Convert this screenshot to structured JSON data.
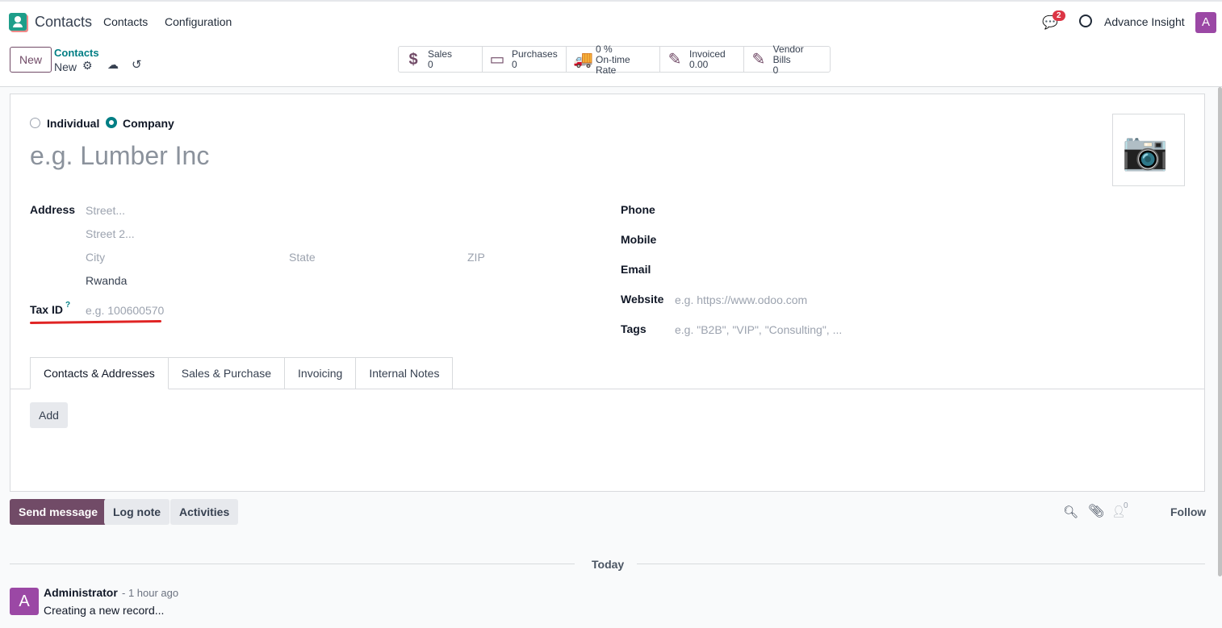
{
  "nav": {
    "app_title": "Contacts",
    "menu": [
      "Contacts",
      "Configuration"
    ],
    "messages_count": "2",
    "user_name": "Advance Insight",
    "avatar_letter": "A"
  },
  "control": {
    "new_label": "New",
    "breadcrumb_parent": "Contacts",
    "breadcrumb_current": "New"
  },
  "stats": [
    {
      "icon": "dollar-icon",
      "label": "Sales",
      "value": "0"
    },
    {
      "icon": "credit-card-icon",
      "label": "Purchases",
      "value": "0"
    },
    {
      "icon": "truck-icon",
      "label": "0 %",
      "value": "On-time Rate"
    },
    {
      "icon": "edit-icon",
      "label": "Invoiced",
      "value": "0.00"
    },
    {
      "icon": "edit-icon",
      "label": "Vendor Bills",
      "value": "0"
    }
  ],
  "form": {
    "type_options": [
      "Individual",
      "Company"
    ],
    "type_selected": "Company",
    "name_placeholder": "e.g. Lumber Inc",
    "address_label": "Address",
    "street_ph": "Street...",
    "street2_ph": "Street 2...",
    "city_ph": "City",
    "state_ph": "State",
    "zip_ph": "ZIP",
    "country": "Rwanda",
    "taxid_label": "Tax ID",
    "taxid_help": "?",
    "taxid_ph": "e.g. 100600570",
    "phone_label": "Phone",
    "mobile_label": "Mobile",
    "email_label": "Email",
    "website_label": "Website",
    "website_ph": "e.g. https://www.odoo.com",
    "tags_label": "Tags",
    "tags_ph": "e.g. \"B2B\", \"VIP\", \"Consulting\", ...",
    "highlight_color": "#e02424"
  },
  "tabs": [
    "Contacts & Addresses",
    "Sales & Purchase",
    "Invoicing",
    "Internal Notes"
  ],
  "add_label": "Add",
  "chatter": {
    "send": "Send message",
    "log": "Log note",
    "activities": "Activities",
    "followers": "0",
    "follow": "Follow",
    "today": "Today",
    "messages": [
      {
        "avatar": "A",
        "author": "Administrator",
        "time": "- 1 hour ago",
        "body": "Creating a new record..."
      }
    ]
  },
  "colors": {
    "brand": "#714b67",
    "accent": "#017e84"
  }
}
